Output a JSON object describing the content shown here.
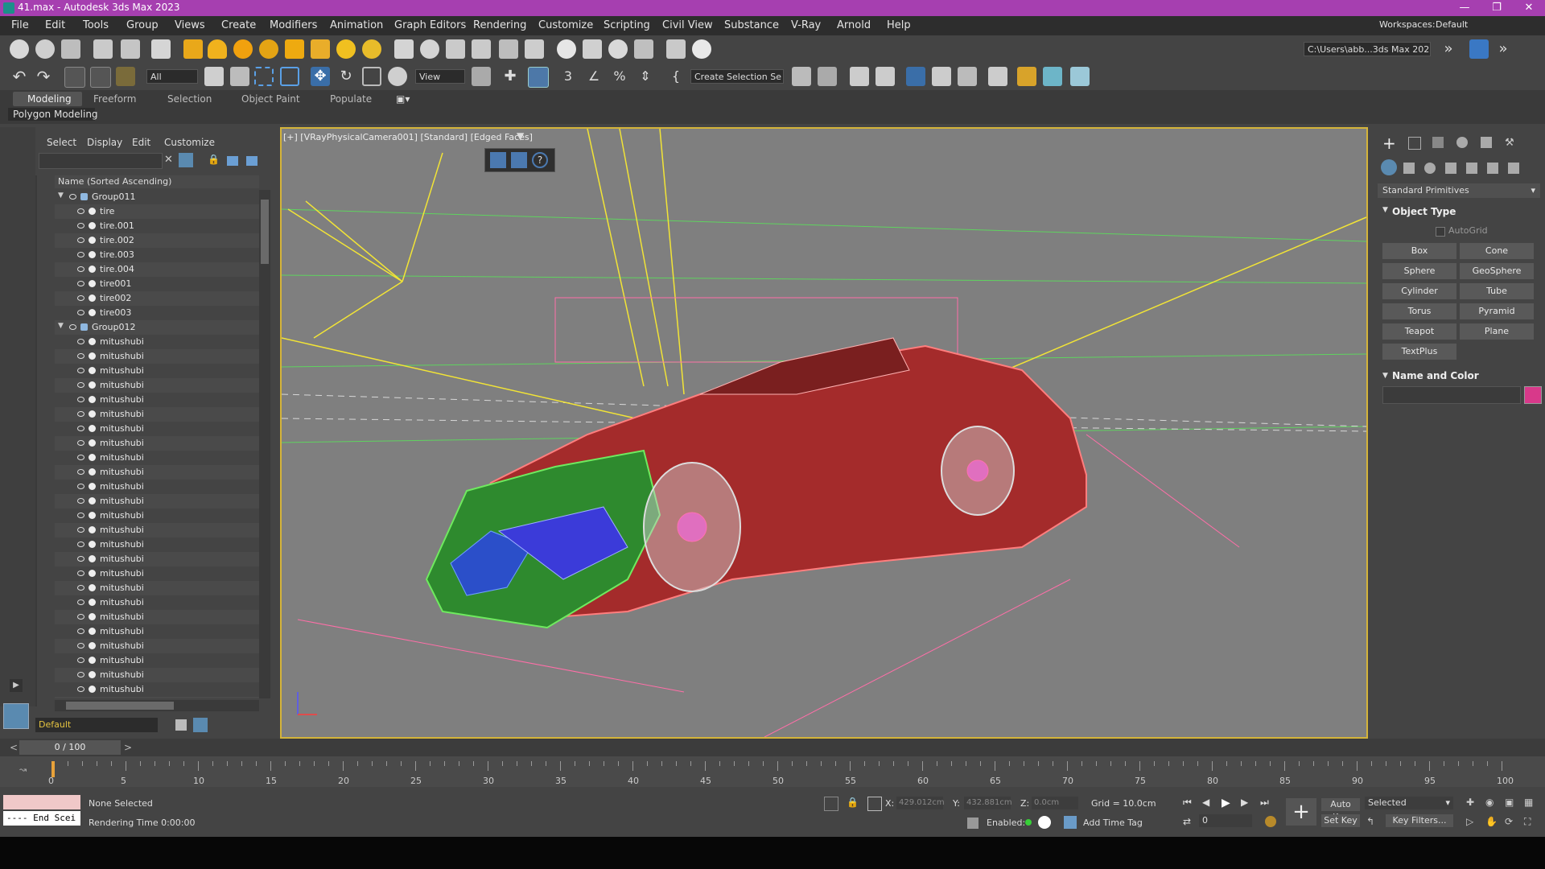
{
  "window": {
    "title": "41.max - Autodesk 3ds Max 2023"
  },
  "menu": [
    "File",
    "Edit",
    "Tools",
    "Group",
    "Views",
    "Create",
    "Modifiers",
    "Animation",
    "Graph Editors",
    "Rendering",
    "Customize",
    "Scripting",
    "Civil View",
    "Substance",
    "V-Ray",
    "Arnold",
    "Help"
  ],
  "workspace": {
    "label": "Workspaces:",
    "value": "Default"
  },
  "project_path": "C:\\Users\\abb...3ds Max 2023",
  "toolbar2": {
    "filter": "All",
    "refcoord": "View",
    "selection_set": "Create Selection Se"
  },
  "ribbon": {
    "tabs": [
      "Modeling",
      "Freeform",
      "Selection",
      "Object Paint",
      "Populate"
    ],
    "panel": "Polygon Modeling"
  },
  "explorer": {
    "tabs": [
      "Select",
      "Display",
      "Edit",
      "Customize"
    ],
    "column_header": "Name (Sorted Ascending)",
    "rows": [
      {
        "name": "Group011",
        "group": true
      },
      {
        "name": "tire"
      },
      {
        "name": "tire.001"
      },
      {
        "name": "tire.002"
      },
      {
        "name": "tire.003"
      },
      {
        "name": "tire.004"
      },
      {
        "name": "tire001"
      },
      {
        "name": "tire002"
      },
      {
        "name": "tire003"
      },
      {
        "name": "Group012",
        "group": true
      },
      {
        "name": "mitushubi"
      },
      {
        "name": "mitushubi"
      },
      {
        "name": "mitushubi"
      },
      {
        "name": "mitushubi"
      },
      {
        "name": "mitushubi"
      },
      {
        "name": "mitushubi"
      },
      {
        "name": "mitushubi"
      },
      {
        "name": "mitushubi"
      },
      {
        "name": "mitushubi"
      },
      {
        "name": "mitushubi"
      },
      {
        "name": "mitushubi"
      },
      {
        "name": "mitushubi"
      },
      {
        "name": "mitushubi"
      },
      {
        "name": "mitushubi"
      },
      {
        "name": "mitushubi"
      },
      {
        "name": "mitushubi"
      },
      {
        "name": "mitushubi"
      },
      {
        "name": "mitushubi"
      },
      {
        "name": "mitushubi"
      },
      {
        "name": "mitushubi"
      },
      {
        "name": "mitushubi"
      },
      {
        "name": "mitushubi"
      },
      {
        "name": "mitushubi"
      },
      {
        "name": "mitushubi"
      },
      {
        "name": "mitushubi"
      },
      {
        "name": "mitushubi"
      },
      {
        "name": "mitushubi"
      }
    ],
    "layer": "Default"
  },
  "viewport": {
    "label": "[+] [VRayPhysicalCamera001] [Standard] [Edged Faces]"
  },
  "cmdpanel": {
    "category": "Standard Primitives",
    "rollout1": "Object Type",
    "autogrid": "AutoGrid",
    "buttons": [
      "Box",
      "Cone",
      "Sphere",
      "GeoSphere",
      "Cylinder",
      "Tube",
      "Torus",
      "Pyramid",
      "Teapot",
      "Plane",
      "TextPlus"
    ],
    "rollout2": "Name and Color",
    "object_color": "#d8398a"
  },
  "timeline": {
    "frame": "0 / 100",
    "ticks": [
      0,
      5,
      10,
      15,
      20,
      25,
      30,
      35,
      40,
      45,
      50,
      55,
      60,
      65,
      70,
      75,
      80,
      85,
      90,
      95,
      100
    ]
  },
  "status": {
    "selection": "None Selected",
    "render_time": "Rendering Time 0:00:00",
    "script": "---- End Scei",
    "x_label": "X:",
    "x_val": "429.012cm",
    "y_label": "Y:",
    "y_val": "432.881cm",
    "z_label": "Z:",
    "z_val": "0.0cm",
    "grid": "Grid = 10.0cm",
    "enabled": "Enabled:",
    "add_time_tag": "Add Time Tag",
    "auto_key": "Auto Key",
    "set_key": "Set Key",
    "key_mode": "Selected",
    "key_filters": "Key Filters...",
    "frame_field": "0"
  }
}
